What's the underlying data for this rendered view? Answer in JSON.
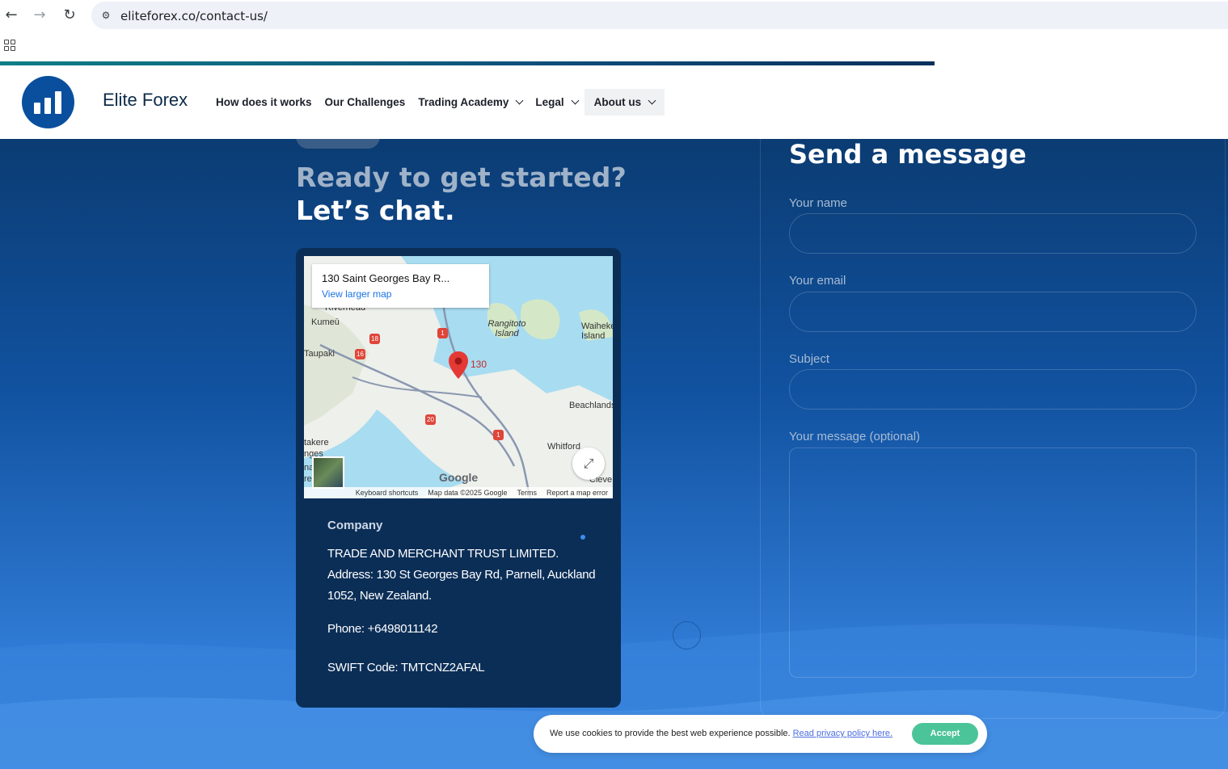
{
  "browser": {
    "url": "eliteforex.co/contact-us/",
    "back_icon": "←",
    "forward_icon": "→",
    "reload_icon": "↻",
    "site_info_icon": "⚙"
  },
  "header": {
    "brand": "Elite Forex",
    "nav": [
      {
        "label": "How does it works"
      },
      {
        "label": "Our Challenges"
      },
      {
        "label": "Trading Academy"
      },
      {
        "label": "Legal"
      },
      {
        "label": "About us"
      }
    ]
  },
  "hero": {
    "line1": "Ready to get started?",
    "line2": "Let’s chat."
  },
  "map": {
    "place_title": "130 Saint Georges Bay R...",
    "view_larger": "View larger map",
    "pin_label": "130",
    "labels": {
      "riverhead": "Riverhead",
      "kumeu": "Kumeū",
      "taupaki": "Taupaki",
      "rangitoto": "Rangitoto Island",
      "waiheke": "Waiheke Island",
      "beachlands": "Beachlands",
      "whitford": "Whitford",
      "waitakere": "takere",
      "ranges": "nges",
      "clevedon": "Cleve",
      "na": "na",
      "re": "re"
    },
    "routes": [
      "18",
      "16",
      "1",
      "20",
      "1"
    ],
    "google": "Google",
    "footer": {
      "shortcuts": "Keyboard shortcuts",
      "data": "Map data ©2025 Google",
      "terms": "Terms",
      "report": "Report a map error"
    }
  },
  "company": {
    "label": "Company",
    "name": "TRADE AND MERCHANT TRUST LIMITED.",
    "address": "Address: 130 St Georges Bay Rd, Parnell, Auckland 1052,  New Zealand.",
    "phone": "Phone: +6498011142",
    "swift": "SWIFT Code: TMTCNZ2AFAL"
  },
  "form": {
    "title": "Send a message",
    "name_label": "Your name",
    "email_label": "Your email",
    "subject_label": "Subject",
    "message_label": "Your message (optional)"
  },
  "cookie": {
    "text": "We use cookies to provide the best web experience possible.",
    "link": "Read privacy policy here.",
    "accept": "Accept"
  },
  "colors": {
    "brand": "#0a4f9e",
    "accept": "#4cc49a",
    "card": "#0b2e57"
  }
}
